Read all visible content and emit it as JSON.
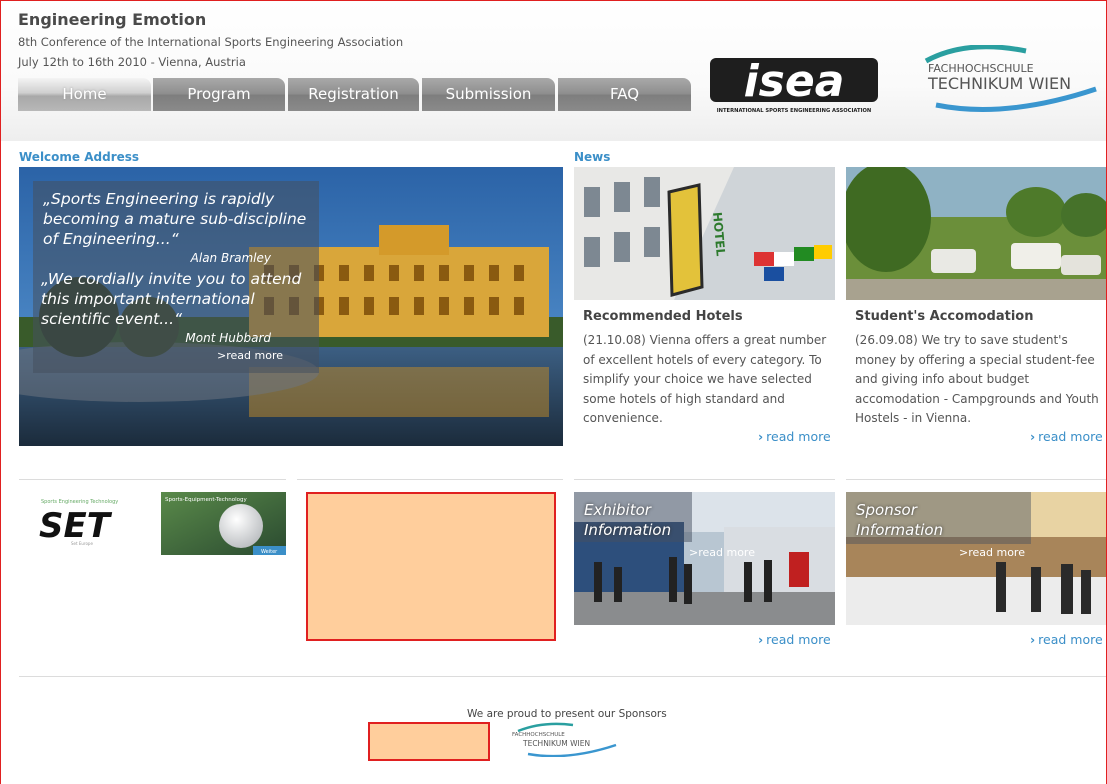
{
  "header": {
    "title": "Engineering Emotion",
    "subtitle": "8th Conference of the International Sports Engineering Association",
    "dates": "July 12th to 16th 2010 - Vienna, Austria"
  },
  "nav": {
    "tabs": [
      {
        "label": "Home",
        "active": true
      },
      {
        "label": "Program",
        "active": false
      },
      {
        "label": "Registration",
        "active": false
      },
      {
        "label": "Submission",
        "active": false
      },
      {
        "label": "FAQ",
        "active": false
      }
    ]
  },
  "logos": {
    "isea_text": "isea",
    "isea_caption": "INTERNATIONAL SPORTS ENGINEERING ASSOCIATION",
    "fh_line1": "FACHHOCHSCHULE",
    "fh_line2": "TECHNIKUM WIEN"
  },
  "welcome": {
    "heading": "Welcome Address",
    "quote1": "„Sports Engineering is rapidly becoming a mature sub-discipline of Engineering...“",
    "author1": "Alan Bramley",
    "quote2": "„We cordially invite you to attend this important international scientific event...“",
    "author2": "Mont Hubbard",
    "read_more": ">read more"
  },
  "news": {
    "heading": "News",
    "items": [
      {
        "title": "Recommended Hotels",
        "body": "(21.10.08) Vienna offers a great number of excellent hotels of every category. To simplify your choice we have selected some hotels of high standard and convenience.",
        "sign": "HOTEL"
      },
      {
        "title": "Student's Accomodation",
        "body": "(26.09.08) We try to save student's money by offering a special student-fee and giving info about budget accomodation - Campgrounds and Youth Hostels - in Vienna."
      }
    ],
    "read_more": "read more"
  },
  "partners": {
    "set_logo": "SET",
    "set_caption": "Sports Engineering Technology",
    "set_footer": "Set Europe",
    "sports_equipment": "Sports-Equipment-Technology",
    "sports_equipment_btn": "Weiter"
  },
  "info": {
    "exhibitor_title": "Exhibitor Information",
    "sponsor_title": "Sponsor Information",
    "read_more_overlay": ">read more",
    "read_more": "read more"
  },
  "footer": {
    "sponsor_text": "We are proud to present our Sponsors",
    "fh_line1": "FACHHOCHSCHULE",
    "fh_line2": "TECHNIKUM WIEN"
  },
  "colors": {
    "accent": "#3b8fc8",
    "placeholder": "#ffce9c",
    "placeholder_border": "#e02020",
    "tab_gray": "#8e8e8e"
  }
}
